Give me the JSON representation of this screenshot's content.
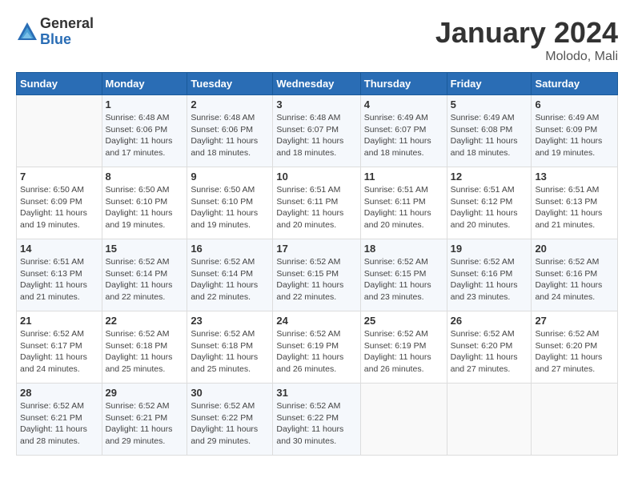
{
  "logo": {
    "general": "General",
    "blue": "Blue"
  },
  "title": "January 2024",
  "location": "Molodo, Mali",
  "days_of_week": [
    "Sunday",
    "Monday",
    "Tuesday",
    "Wednesday",
    "Thursday",
    "Friday",
    "Saturday"
  ],
  "weeks": [
    [
      {
        "day": "",
        "info": ""
      },
      {
        "day": "1",
        "info": "Sunrise: 6:48 AM\nSunset: 6:06 PM\nDaylight: 11 hours and 17 minutes."
      },
      {
        "day": "2",
        "info": "Sunrise: 6:48 AM\nSunset: 6:06 PM\nDaylight: 11 hours and 18 minutes."
      },
      {
        "day": "3",
        "info": "Sunrise: 6:48 AM\nSunset: 6:07 PM\nDaylight: 11 hours and 18 minutes."
      },
      {
        "day": "4",
        "info": "Sunrise: 6:49 AM\nSunset: 6:07 PM\nDaylight: 11 hours and 18 minutes."
      },
      {
        "day": "5",
        "info": "Sunrise: 6:49 AM\nSunset: 6:08 PM\nDaylight: 11 hours and 18 minutes."
      },
      {
        "day": "6",
        "info": "Sunrise: 6:49 AM\nSunset: 6:09 PM\nDaylight: 11 hours and 19 minutes."
      }
    ],
    [
      {
        "day": "7",
        "info": "Sunrise: 6:50 AM\nSunset: 6:09 PM\nDaylight: 11 hours and 19 minutes."
      },
      {
        "day": "8",
        "info": "Sunrise: 6:50 AM\nSunset: 6:10 PM\nDaylight: 11 hours and 19 minutes."
      },
      {
        "day": "9",
        "info": "Sunrise: 6:50 AM\nSunset: 6:10 PM\nDaylight: 11 hours and 19 minutes."
      },
      {
        "day": "10",
        "info": "Sunrise: 6:51 AM\nSunset: 6:11 PM\nDaylight: 11 hours and 20 minutes."
      },
      {
        "day": "11",
        "info": "Sunrise: 6:51 AM\nSunset: 6:11 PM\nDaylight: 11 hours and 20 minutes."
      },
      {
        "day": "12",
        "info": "Sunrise: 6:51 AM\nSunset: 6:12 PM\nDaylight: 11 hours and 20 minutes."
      },
      {
        "day": "13",
        "info": "Sunrise: 6:51 AM\nSunset: 6:13 PM\nDaylight: 11 hours and 21 minutes."
      }
    ],
    [
      {
        "day": "14",
        "info": "Sunrise: 6:51 AM\nSunset: 6:13 PM\nDaylight: 11 hours and 21 minutes."
      },
      {
        "day": "15",
        "info": "Sunrise: 6:52 AM\nSunset: 6:14 PM\nDaylight: 11 hours and 22 minutes."
      },
      {
        "day": "16",
        "info": "Sunrise: 6:52 AM\nSunset: 6:14 PM\nDaylight: 11 hours and 22 minutes."
      },
      {
        "day": "17",
        "info": "Sunrise: 6:52 AM\nSunset: 6:15 PM\nDaylight: 11 hours and 22 minutes."
      },
      {
        "day": "18",
        "info": "Sunrise: 6:52 AM\nSunset: 6:15 PM\nDaylight: 11 hours and 23 minutes."
      },
      {
        "day": "19",
        "info": "Sunrise: 6:52 AM\nSunset: 6:16 PM\nDaylight: 11 hours and 23 minutes."
      },
      {
        "day": "20",
        "info": "Sunrise: 6:52 AM\nSunset: 6:16 PM\nDaylight: 11 hours and 24 minutes."
      }
    ],
    [
      {
        "day": "21",
        "info": "Sunrise: 6:52 AM\nSunset: 6:17 PM\nDaylight: 11 hours and 24 minutes."
      },
      {
        "day": "22",
        "info": "Sunrise: 6:52 AM\nSunset: 6:18 PM\nDaylight: 11 hours and 25 minutes."
      },
      {
        "day": "23",
        "info": "Sunrise: 6:52 AM\nSunset: 6:18 PM\nDaylight: 11 hours and 25 minutes."
      },
      {
        "day": "24",
        "info": "Sunrise: 6:52 AM\nSunset: 6:19 PM\nDaylight: 11 hours and 26 minutes."
      },
      {
        "day": "25",
        "info": "Sunrise: 6:52 AM\nSunset: 6:19 PM\nDaylight: 11 hours and 26 minutes."
      },
      {
        "day": "26",
        "info": "Sunrise: 6:52 AM\nSunset: 6:20 PM\nDaylight: 11 hours and 27 minutes."
      },
      {
        "day": "27",
        "info": "Sunrise: 6:52 AM\nSunset: 6:20 PM\nDaylight: 11 hours and 27 minutes."
      }
    ],
    [
      {
        "day": "28",
        "info": "Sunrise: 6:52 AM\nSunset: 6:21 PM\nDaylight: 11 hours and 28 minutes."
      },
      {
        "day": "29",
        "info": "Sunrise: 6:52 AM\nSunset: 6:21 PM\nDaylight: 11 hours and 29 minutes."
      },
      {
        "day": "30",
        "info": "Sunrise: 6:52 AM\nSunset: 6:22 PM\nDaylight: 11 hours and 29 minutes."
      },
      {
        "day": "31",
        "info": "Sunrise: 6:52 AM\nSunset: 6:22 PM\nDaylight: 11 hours and 30 minutes."
      },
      {
        "day": "",
        "info": ""
      },
      {
        "day": "",
        "info": ""
      },
      {
        "day": "",
        "info": ""
      }
    ]
  ]
}
